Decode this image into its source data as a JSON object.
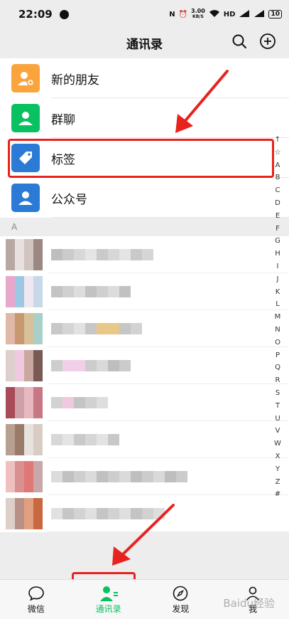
{
  "status": {
    "time": "22:09",
    "net_speed_value": "3.00",
    "net_speed_unit": "KB/S",
    "hd": "HD",
    "battery": "10"
  },
  "nav": {
    "title": "通讯录"
  },
  "fixed_items": [
    {
      "label": "新的朋友",
      "color": "#f9a43c"
    },
    {
      "label": "群聊",
      "color": "#08c160"
    },
    {
      "label": "标签",
      "color": "#2b7ad6"
    },
    {
      "label": "公众号",
      "color": "#2b7ad6"
    }
  ],
  "section": "A",
  "index_letters": [
    "↑",
    "☆",
    "A",
    "B",
    "C",
    "D",
    "E",
    "F",
    "G",
    "H",
    "I",
    "J",
    "K",
    "L",
    "M",
    "N",
    "O",
    "P",
    "Q",
    "R",
    "S",
    "T",
    "U",
    "V",
    "W",
    "X",
    "Y",
    "Z",
    "#"
  ],
  "tabs": [
    {
      "label": "微信",
      "icon": "chat-icon"
    },
    {
      "label": "通讯录",
      "icon": "contacts-icon",
      "active": true
    },
    {
      "label": "发现",
      "icon": "compass-icon"
    },
    {
      "label": "我",
      "icon": "person-icon"
    }
  ],
  "watermark": "Baidu经验"
}
